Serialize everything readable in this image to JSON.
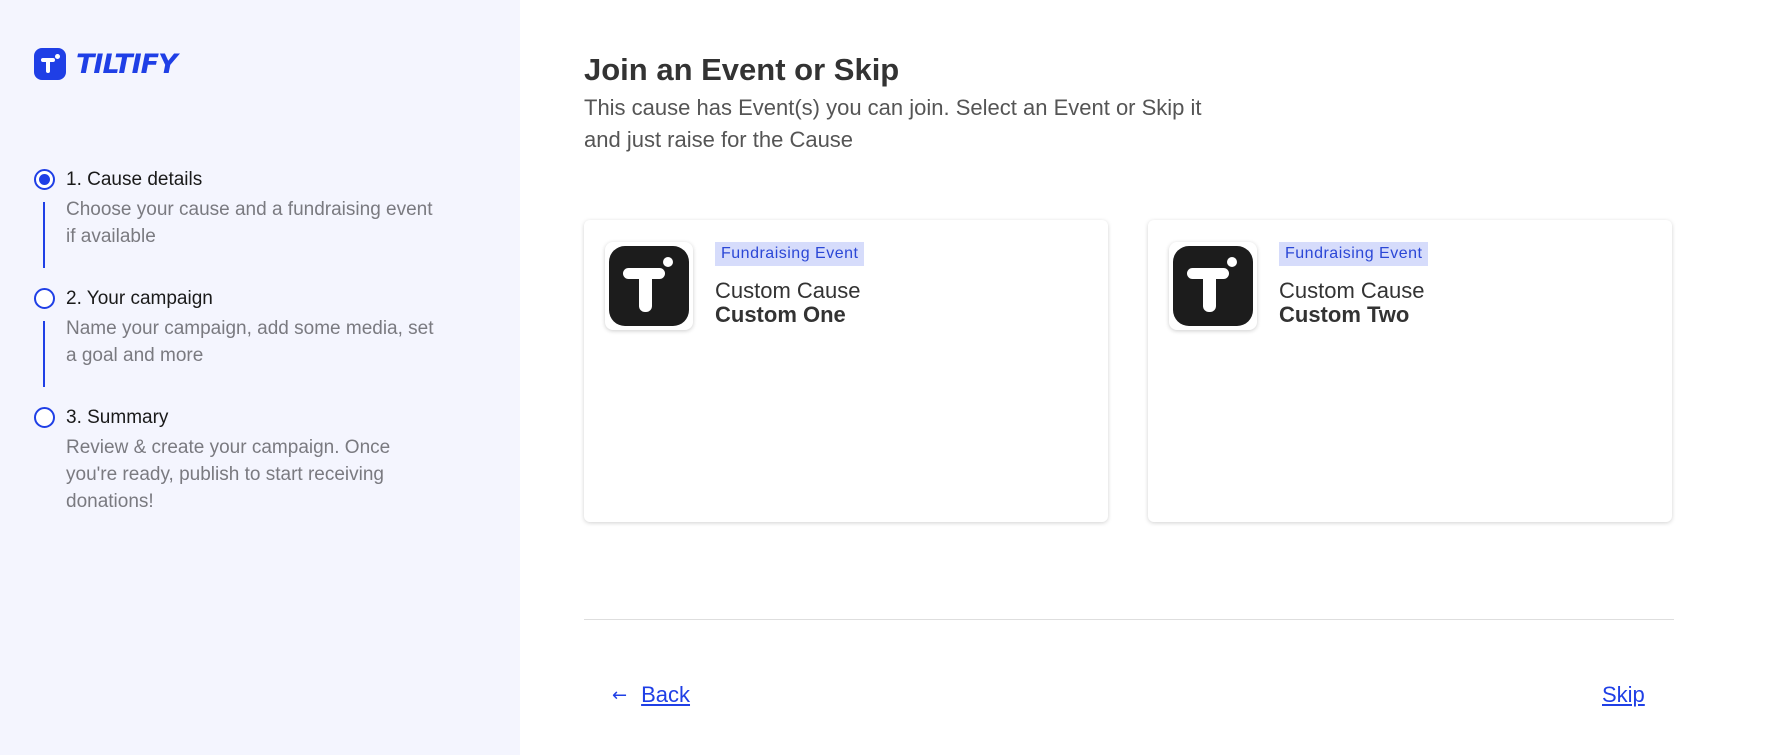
{
  "brand": {
    "name": "TILTIFY",
    "color": "#1f3fe6"
  },
  "steps": [
    {
      "title": "1. Cause details",
      "description": "Choose your cause and a fundraising event if available",
      "active": true
    },
    {
      "title": "2. Your campaign",
      "description": "Name your campaign, add some media, set a goal and more",
      "active": false
    },
    {
      "title": "3. Summary",
      "description": "Review & create your campaign. Once you're ready, publish to start receiving donations!",
      "active": false
    }
  ],
  "main": {
    "heading": "Join an Event or Skip",
    "subheading": "This cause has Event(s) you can join. Select an Event or Skip it and just raise for the Cause"
  },
  "events": [
    {
      "badge": "Fundraising Event",
      "cause": "Custom Cause",
      "name": "Custom One",
      "logo_icon": "tiltify-logo-icon"
    },
    {
      "badge": "Fundraising Event",
      "cause": "Custom Cause",
      "name": "Custom Two",
      "logo_icon": "tiltify-logo-icon"
    }
  ],
  "footer": {
    "back_icon": "arrow-left-icon",
    "back_label": "Back",
    "skip_label": "Skip"
  }
}
